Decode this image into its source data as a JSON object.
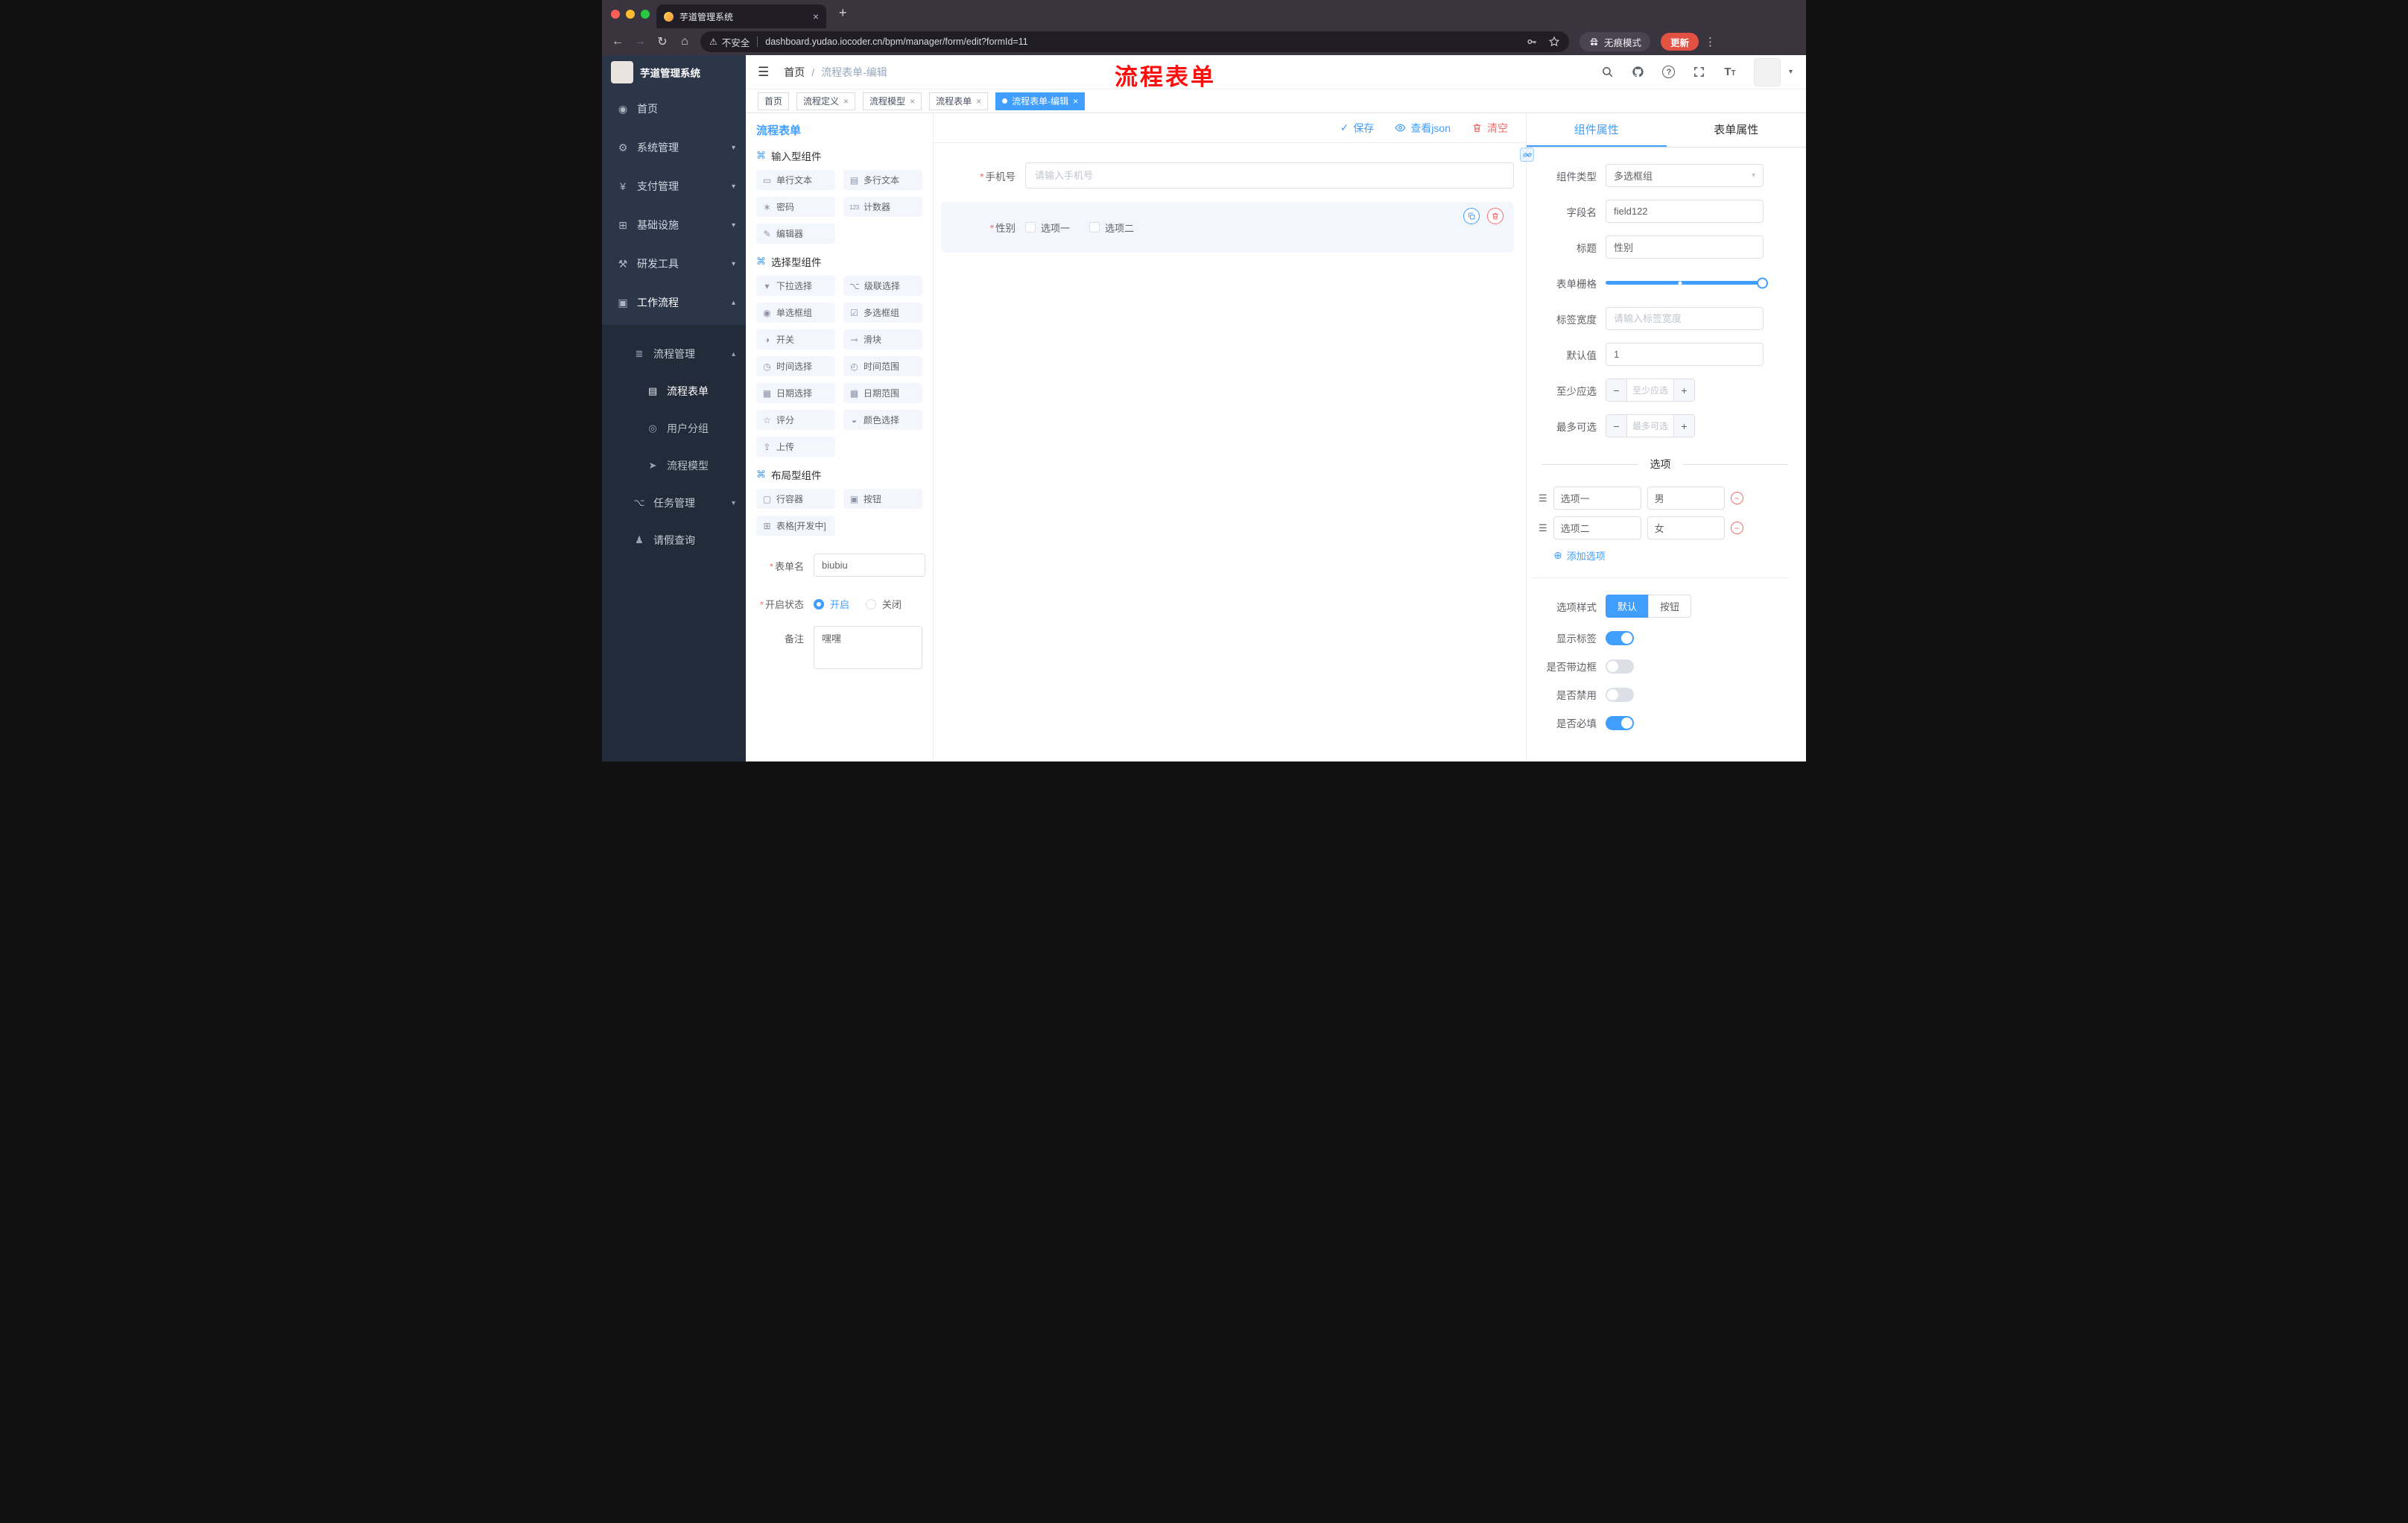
{
  "browser": {
    "tab_title": "芋道管理系统",
    "security": "不安全",
    "url": "dashboard.yudao.iocoder.cn/bpm/manager/form/edit?formId=11",
    "incognito": "无痕模式",
    "update": "更新"
  },
  "annotation": "流程表单",
  "icons": {
    "close": "×",
    "plus": "+",
    "back": "←",
    "forward": "→",
    "reload": "↻",
    "home": "⌂",
    "warning": "⚠",
    "kebab": "⋮",
    "hamburger": "☰",
    "chevron_down": "▾",
    "chevron_up": "▴",
    "check": "✓",
    "question": "?",
    "font_big": "T",
    "font_small": "T",
    "side_home": "◉",
    "side_system": "⚙",
    "side_pay": "¥",
    "side_infra": "⊞",
    "side_dev": "⚒",
    "side_flow": "▣",
    "side_flow_mgmt": "≣",
    "side_form": "▤",
    "side_group": "◎",
    "side_model": "➤",
    "side_task": "⌥",
    "side_leave": "♟",
    "group": "⌘",
    "c_single": "▭",
    "c_multi": "▤",
    "c_password": "∗",
    "c_counter": "123",
    "c_editor": "✎",
    "c_select": "▾",
    "c_cascade": "⌥",
    "c_radio": "◉",
    "c_checkbox": "☑",
    "c_switch": "◑",
    "c_slider": "⊸",
    "c_time": "◷",
    "c_time_range": "◴",
    "c_date": "▦",
    "c_date_range": "▩",
    "c_rate": "☆",
    "c_color": "◒",
    "c_upload": "⇪",
    "c_row": "▢",
    "c_button": "▣",
    "c_table": "⊞",
    "opt_handle": "☰",
    "add_circle": "⊕",
    "minus": "−",
    "plus_sign": "+"
  },
  "sidebar": {
    "app_title": "芋道管理系统",
    "items": [
      {
        "label": "首页"
      },
      {
        "label": "系统管理"
      },
      {
        "label": "支付管理"
      },
      {
        "label": "基础设施"
      },
      {
        "label": "研发工具"
      },
      {
        "label": "工作流程"
      }
    ],
    "process_group": "流程管理",
    "process_children": [
      {
        "label": "流程表单"
      },
      {
        "label": "用户分组"
      },
      {
        "label": "流程模型"
      }
    ],
    "task_group": "任务管理",
    "leave_query": "请假查询"
  },
  "header": {
    "breadcrumb_home": "首页",
    "breadcrumb_sep": "/",
    "breadcrumb_current": "流程表单-编辑"
  },
  "tags": [
    {
      "label": "首页"
    },
    {
      "label": "流程定义"
    },
    {
      "label": "流程模型"
    },
    {
      "label": "流程表单"
    },
    {
      "label": "流程表单-编辑"
    }
  ],
  "left_panel": {
    "title": "流程表单",
    "groups": [
      {
        "title": "输入型组件"
      },
      {
        "title": "选择型组件"
      },
      {
        "title": "布局型组件"
      }
    ],
    "components": {
      "input": [
        "单行文本",
        "多行文本",
        "密码",
        "计数器",
        "编辑器"
      ],
      "select": [
        "下拉选择",
        "级联选择",
        "单选框组",
        "多选框组",
        "开关",
        "滑块",
        "时间选择",
        "时间范围",
        "日期选择",
        "日期范围",
        "评分",
        "颜色选择",
        "上传"
      ],
      "layout": [
        "行容器",
        "按钮",
        "表格[开发中]"
      ]
    },
    "form": {
      "name_label": "表单名",
      "name_value": "biubiu",
      "status_label": "开启状态",
      "status_on": "开启",
      "status_off": "关闭",
      "remark_label": "备注",
      "remark_value": "嘿嘿"
    }
  },
  "canvas": {
    "save": "保存",
    "view_json": "查看json",
    "clear": "清空",
    "phone_label": "手机号",
    "phone_placeholder": "请输入手机号",
    "gender_label": "性别",
    "gender_options": [
      "选项一",
      "选项二"
    ]
  },
  "props": {
    "tab_component": "组件属性",
    "tab_form": "表单属性",
    "component_type_label": "组件类型",
    "component_type_value": "多选框组",
    "field_name_label": "字段名",
    "field_name_value": "field122",
    "title_label": "标题",
    "title_value": "性别",
    "grid_label": "表单栅格",
    "label_width_label": "标签宽度",
    "label_width_placeholder": "请输入标签宽度",
    "default_label": "默认值",
    "default_value": "1",
    "min_label": "至少应选",
    "min_placeholder": "至少应选",
    "max_label": "最多可选",
    "max_placeholder": "最多可选",
    "options_title": "选项",
    "options": [
      {
        "label": "选项一",
        "value": "男"
      },
      {
        "label": "选项二",
        "value": "女"
      }
    ],
    "add_option": "添加选项",
    "style_label": "选项样式",
    "style_default": "默认",
    "style_button": "按钮",
    "switch_show_label": "显示标签",
    "switch_border": "是否带边框",
    "switch_disabled": "是否禁用",
    "switch_required": "是否必填"
  }
}
